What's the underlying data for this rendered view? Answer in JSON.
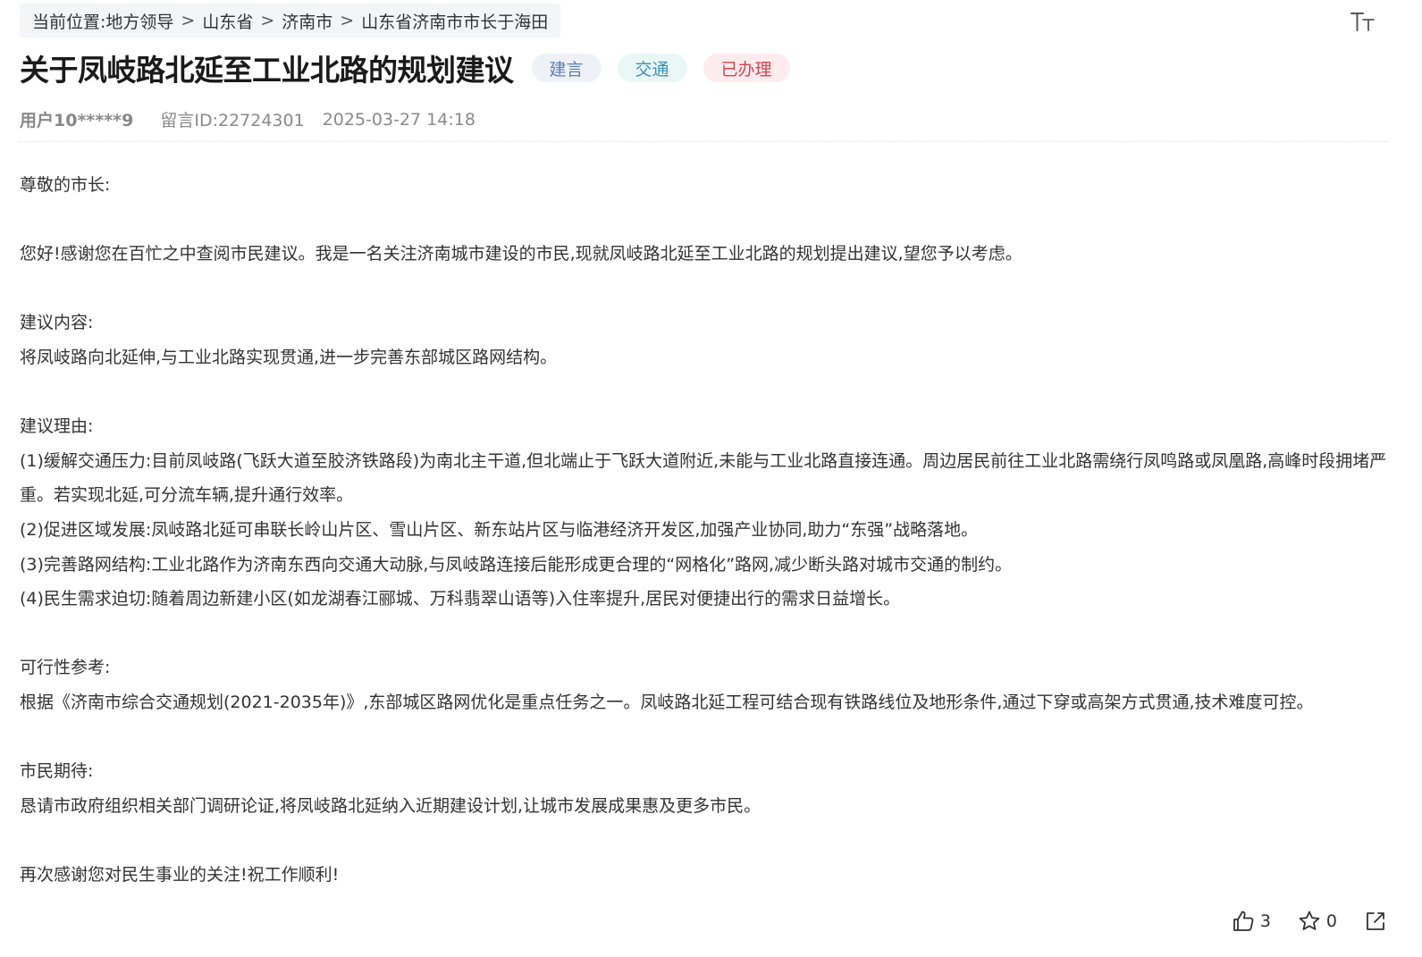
{
  "breadcrumb": {
    "prefix": "当前位置:",
    "items": [
      "地方领导",
      "山东省",
      "济南市",
      "山东省济南市市长于海田"
    ],
    "separator": ">"
  },
  "toolbar": {
    "font_size_icon": "font-size-icon"
  },
  "message": {
    "title": "关于凤岐路北延至工业北路的规划建议",
    "tags": {
      "type": "建言",
      "field": "交通",
      "status": "已办理"
    },
    "user": "用户10*****9",
    "message_id": "留言ID:22724301",
    "time": "2025-03-27 14:18",
    "body": {
      "greeting": "尊敬的市长:",
      "intro": "您好!感谢您在百忙之中查阅市民建议。我是一名关注济南城市建设的市民,现就凤岐路北延至工业北路的规划提出建议,望您予以考虑。",
      "content_heading": "建议内容:",
      "content_text": "将凤岐路向北延伸,与工业北路实现贯通,进一步完善东部城区路网结构。",
      "reasons_heading": "建议理由:",
      "reason_1": "(1)缓解交通压力:目前凤岐路(飞跃大道至胶济铁路段)为南北主干道,但北端止于飞跃大道附近,未能与工业北路直接连通。周边居民前往工业北路需绕行凤鸣路或凤凰路,高峰时段拥堵严重。若实现北延,可分流车辆,提升通行效率。",
      "reason_2": "(2)促进区域发展:凤岐路北延可串联长岭山片区、雪山片区、新东站片区与临港经济开发区,加强产业协同,助力“东强”战略落地。",
      "reason_3": "(3)完善路网结构:工业北路作为济南东西向交通大动脉,与凤岐路连接后能形成更合理的“网格化”路网,减少断头路对城市交通的制约。",
      "reason_4": "(4)民生需求迫切:随着周边新建小区(如龙湖春江郦城、万科翡翠山语等)入住率提升,居民对便捷出行的需求日益增长。",
      "feasibility_heading": "可行性参考:",
      "feasibility_text": "根据《济南市综合交通规划(2021-2035年)》,东部城区路网优化是重点任务之一。凤岐路北延工程可结合现有铁路线位及地形条件,通过下穿或高架方式贯通,技术难度可控。",
      "expectation_heading": "市民期待:",
      "expectation_text": "恳请市政府组织相关部门调研论证,将凤岐路北延纳入近期建设计划,让城市发展成果惠及更多市民。",
      "closing": "再次感谢您对民生事业的关注!祝工作顺利!"
    }
  },
  "actions": {
    "like_count": "3",
    "favorite_count": "0",
    "like_icon": "thumbs-up-icon",
    "favorite_icon": "star-icon",
    "share_icon": "share-icon"
  },
  "colors": {
    "tag_type_text": "#5b7fb8",
    "tag_field_text": "#3a8fb7",
    "tag_status_text": "#d9424f",
    "breadcrumb_bg": "#f4f5f7"
  }
}
